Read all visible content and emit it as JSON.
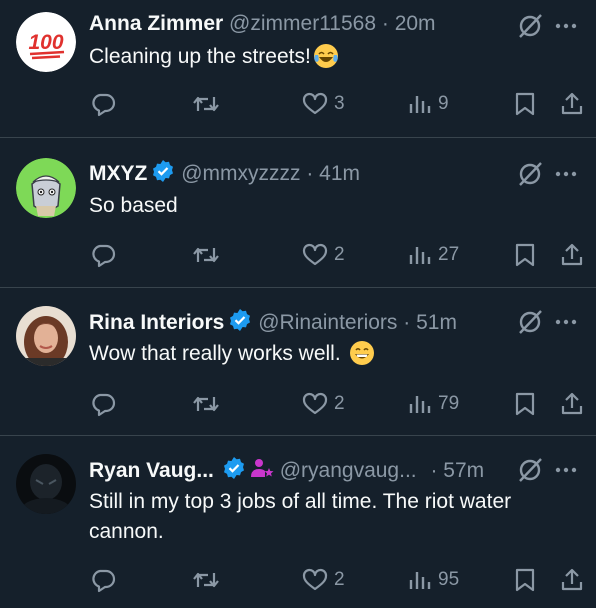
{
  "colors": {
    "background": "#15202b",
    "text": "#f7f9f9",
    "muted": "#8b98a5",
    "divider": "#38444d",
    "verified": "#1d9bf0",
    "affiliate": "#c936cc"
  },
  "tweets": [
    {
      "name": "Anna Zimmer",
      "handle": "@zimmer11568",
      "time": "· 20m",
      "text": "Cleaning up the streets!",
      "text_emoji": "face-with-tears-of-joy",
      "verified": false,
      "avatar_icon": "hundred-points-icon",
      "avatar_text": "100",
      "replies": "",
      "reposts": "",
      "likes": "3",
      "views": "9"
    },
    {
      "name": "MXYZ",
      "handle": "@mmxyzzzz",
      "time": "· 41m",
      "text": "So based",
      "verified": true,
      "avatar_icon": "cartoon-avatar-icon",
      "replies": "",
      "reposts": "",
      "likes": "2",
      "views": "27"
    },
    {
      "name": "Rina Interiors",
      "handle": "@Rinainteriors",
      "time": "· 51m",
      "text": "Wow that really works well.",
      "text_emoji": "grinning-face",
      "verified": true,
      "avatar_icon": "photo-avatar-icon",
      "replies": "",
      "reposts": "",
      "likes": "2",
      "views": "79"
    },
    {
      "name": "Ryan Vaug...",
      "handle": "@ryangvaug...",
      "time": "· 57m",
      "text": "Still in my top 3 jobs of all time. The riot water cannon.",
      "verified": true,
      "affiliate_badge": "person-star-icon",
      "avatar_icon": "dark-photo-avatar-icon",
      "replies": "",
      "reposts": "",
      "likes": "2",
      "views": "95"
    }
  ]
}
